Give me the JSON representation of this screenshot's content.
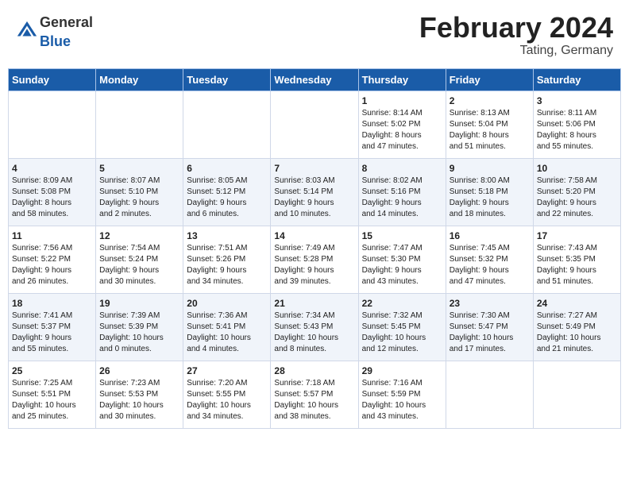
{
  "header": {
    "logo_general": "General",
    "logo_blue": "Blue",
    "title": "February 2024",
    "subtitle": "Tating, Germany"
  },
  "days_of_week": [
    "Sunday",
    "Monday",
    "Tuesday",
    "Wednesday",
    "Thursday",
    "Friday",
    "Saturday"
  ],
  "weeks": [
    [
      {
        "day": "",
        "info": ""
      },
      {
        "day": "",
        "info": ""
      },
      {
        "day": "",
        "info": ""
      },
      {
        "day": "",
        "info": ""
      },
      {
        "day": "1",
        "info": "Sunrise: 8:14 AM\nSunset: 5:02 PM\nDaylight: 8 hours\nand 47 minutes."
      },
      {
        "day": "2",
        "info": "Sunrise: 8:13 AM\nSunset: 5:04 PM\nDaylight: 8 hours\nand 51 minutes."
      },
      {
        "day": "3",
        "info": "Sunrise: 8:11 AM\nSunset: 5:06 PM\nDaylight: 8 hours\nand 55 minutes."
      }
    ],
    [
      {
        "day": "4",
        "info": "Sunrise: 8:09 AM\nSunset: 5:08 PM\nDaylight: 8 hours\nand 58 minutes."
      },
      {
        "day": "5",
        "info": "Sunrise: 8:07 AM\nSunset: 5:10 PM\nDaylight: 9 hours\nand 2 minutes."
      },
      {
        "day": "6",
        "info": "Sunrise: 8:05 AM\nSunset: 5:12 PM\nDaylight: 9 hours\nand 6 minutes."
      },
      {
        "day": "7",
        "info": "Sunrise: 8:03 AM\nSunset: 5:14 PM\nDaylight: 9 hours\nand 10 minutes."
      },
      {
        "day": "8",
        "info": "Sunrise: 8:02 AM\nSunset: 5:16 PM\nDaylight: 9 hours\nand 14 minutes."
      },
      {
        "day": "9",
        "info": "Sunrise: 8:00 AM\nSunset: 5:18 PM\nDaylight: 9 hours\nand 18 minutes."
      },
      {
        "day": "10",
        "info": "Sunrise: 7:58 AM\nSunset: 5:20 PM\nDaylight: 9 hours\nand 22 minutes."
      }
    ],
    [
      {
        "day": "11",
        "info": "Sunrise: 7:56 AM\nSunset: 5:22 PM\nDaylight: 9 hours\nand 26 minutes."
      },
      {
        "day": "12",
        "info": "Sunrise: 7:54 AM\nSunset: 5:24 PM\nDaylight: 9 hours\nand 30 minutes."
      },
      {
        "day": "13",
        "info": "Sunrise: 7:51 AM\nSunset: 5:26 PM\nDaylight: 9 hours\nand 34 minutes."
      },
      {
        "day": "14",
        "info": "Sunrise: 7:49 AM\nSunset: 5:28 PM\nDaylight: 9 hours\nand 39 minutes."
      },
      {
        "day": "15",
        "info": "Sunrise: 7:47 AM\nSunset: 5:30 PM\nDaylight: 9 hours\nand 43 minutes."
      },
      {
        "day": "16",
        "info": "Sunrise: 7:45 AM\nSunset: 5:32 PM\nDaylight: 9 hours\nand 47 minutes."
      },
      {
        "day": "17",
        "info": "Sunrise: 7:43 AM\nSunset: 5:35 PM\nDaylight: 9 hours\nand 51 minutes."
      }
    ],
    [
      {
        "day": "18",
        "info": "Sunrise: 7:41 AM\nSunset: 5:37 PM\nDaylight: 9 hours\nand 55 minutes."
      },
      {
        "day": "19",
        "info": "Sunrise: 7:39 AM\nSunset: 5:39 PM\nDaylight: 10 hours\nand 0 minutes."
      },
      {
        "day": "20",
        "info": "Sunrise: 7:36 AM\nSunset: 5:41 PM\nDaylight: 10 hours\nand 4 minutes."
      },
      {
        "day": "21",
        "info": "Sunrise: 7:34 AM\nSunset: 5:43 PM\nDaylight: 10 hours\nand 8 minutes."
      },
      {
        "day": "22",
        "info": "Sunrise: 7:32 AM\nSunset: 5:45 PM\nDaylight: 10 hours\nand 12 minutes."
      },
      {
        "day": "23",
        "info": "Sunrise: 7:30 AM\nSunset: 5:47 PM\nDaylight: 10 hours\nand 17 minutes."
      },
      {
        "day": "24",
        "info": "Sunrise: 7:27 AM\nSunset: 5:49 PM\nDaylight: 10 hours\nand 21 minutes."
      }
    ],
    [
      {
        "day": "25",
        "info": "Sunrise: 7:25 AM\nSunset: 5:51 PM\nDaylight: 10 hours\nand 25 minutes."
      },
      {
        "day": "26",
        "info": "Sunrise: 7:23 AM\nSunset: 5:53 PM\nDaylight: 10 hours\nand 30 minutes."
      },
      {
        "day": "27",
        "info": "Sunrise: 7:20 AM\nSunset: 5:55 PM\nDaylight: 10 hours\nand 34 minutes."
      },
      {
        "day": "28",
        "info": "Sunrise: 7:18 AM\nSunset: 5:57 PM\nDaylight: 10 hours\nand 38 minutes."
      },
      {
        "day": "29",
        "info": "Sunrise: 7:16 AM\nSunset: 5:59 PM\nDaylight: 10 hours\nand 43 minutes."
      },
      {
        "day": "",
        "info": ""
      },
      {
        "day": "",
        "info": ""
      }
    ]
  ]
}
